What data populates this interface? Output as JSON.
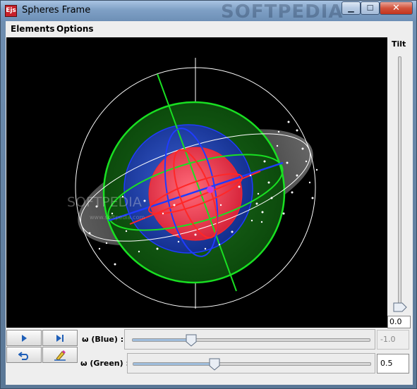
{
  "window": {
    "title": "Spheres Frame",
    "icon_text": "Ejs",
    "watermark": "SOFTPEDIA"
  },
  "menu": {
    "items": [
      {
        "label": "Elements"
      },
      {
        "label": "Options"
      }
    ]
  },
  "canvas": {
    "background": "#000000",
    "watermark": "SOFTPEDIA",
    "watermark_url": "www.softpedia.com",
    "colors": {
      "blue": "#1f3cff",
      "green": "#19e022",
      "red": "#ff2727",
      "white": "#ffffff"
    }
  },
  "tilt": {
    "label": "Tilt",
    "value": "0.0",
    "level": 0.0
  },
  "controls": {
    "play_icon": "play-icon",
    "step_icon": "step-forward-icon",
    "reset_icon": "reset-icon",
    "clear_icon": "clear-trail-icon"
  },
  "sliders": [
    {
      "label": "ω  (Blue) :",
      "value": "-1.0",
      "enabled": false,
      "fraction": 0.25
    },
    {
      "label": "ω (Green) :",
      "value": "0.5",
      "enabled": true,
      "fraction": 0.34
    }
  ]
}
